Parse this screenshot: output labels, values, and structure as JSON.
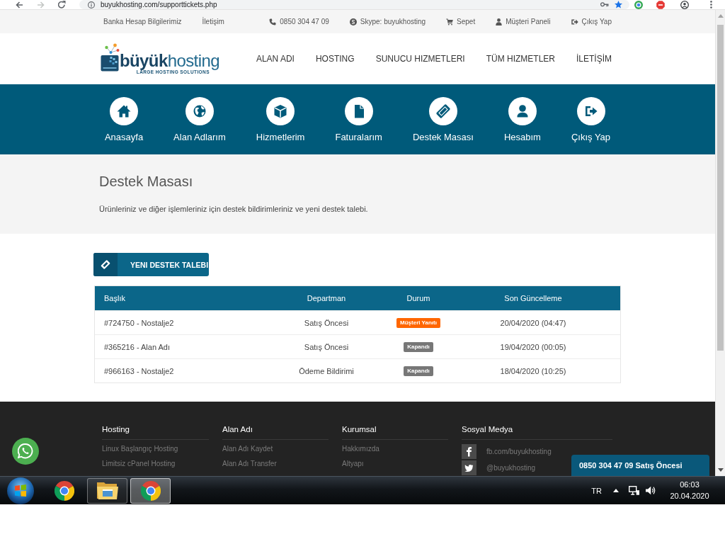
{
  "browser": {
    "url": "buyukhosting.com/supporttickets.php"
  },
  "top_bar": {
    "links": [
      {
        "label": "Banka Hesap Bilgilerimiz"
      },
      {
        "label": "İletişim"
      }
    ],
    "contacts": [
      {
        "kind": "phone",
        "label": "0850 304 47 09"
      },
      {
        "kind": "skype",
        "label": "Skype: buyukhosting"
      },
      {
        "kind": "cart",
        "label": "Sepet"
      },
      {
        "kind": "user",
        "label": "Müşteri Paneli"
      },
      {
        "kind": "logout",
        "label": "Çıkış Yap"
      }
    ]
  },
  "header": {
    "logo": {
      "wordmark": "**büyük**hosting",
      "tagline": "LARGE HOSTING SOLUTIONS"
    },
    "nav": [
      "ALAN ADI",
      "HOSTING",
      "SUNUCU HIZMETLERI",
      "TÜM HIZMETLER",
      "İLETİŞİM"
    ]
  },
  "quick_menu": [
    {
      "kind": "home",
      "label": "Anasayfa"
    },
    {
      "kind": "globe",
      "label": "Alan Adlarım"
    },
    {
      "kind": "box",
      "label": "Hizmetlerim"
    },
    {
      "kind": "file",
      "label": "Faturalarım"
    },
    {
      "kind": "ticket",
      "label": "Destek Masası"
    },
    {
      "kind": "user",
      "label": "Hesabım"
    },
    {
      "kind": "logout",
      "label": "Çıkış Yap"
    }
  ],
  "page_header": {
    "title": "Destek Masası",
    "description": "Ürünleriniz ve diğer işlemleriniz için destek bildirimleriniz ve yeni destek talebi."
  },
  "new_ticket_button": {
    "label": "YENI DESTEK TALEBI"
  },
  "table": {
    "columns": [
      "Başlık",
      "Departman",
      "Durum",
      "Son Güncelleme"
    ],
    "rows": [
      {
        "title": "#724750 - Nostalje2",
        "department": "Satış Öncesi",
        "status": "Müşteri Yanıtı",
        "color": "#ff6600",
        "updated": "20/04/2020 (04:47)"
      },
      {
        "title": "#365216 - Alan Adı",
        "department": "Satış Öncesi",
        "status": "Kapandı",
        "color": "#777777",
        "updated": "19/04/2020 (00:05)"
      },
      {
        "title": "#966163 - Nostalje2",
        "department": "Ödeme Bildirimi",
        "status": "Kapandı",
        "color": "#777777",
        "updated": "18/04/2020 (10:25)"
      }
    ]
  },
  "footer": {
    "columns": [
      {
        "title": "Hosting",
        "links": [
          "Linux Başlangıç Hosting",
          "Limitsiz cPanel Hosting"
        ]
      },
      {
        "title": "Alan Adı",
        "links": [
          "Alan Adı Kaydet",
          "Alan Adı Transfer"
        ]
      },
      {
        "title": "Kurumsal",
        "links": [
          "Hakkımızda",
          "Altyapı"
        ]
      }
    ],
    "social": {
      "title": "Sosyal Medya",
      "items": [
        {
          "kind": "facebook",
          "label": "fb.com/buyukhosting"
        },
        {
          "kind": "twitter",
          "label": "@buyukhosting"
        }
      ]
    }
  },
  "chat_widget": {
    "label": "0850 304 47 09 Satış Öncesi"
  },
  "taskbar": {
    "apps": [
      {
        "kind": "browser",
        "running": false,
        "selected": false
      },
      {
        "kind": "folder",
        "running": true,
        "selected": false
      },
      {
        "kind": "browser",
        "running": true,
        "selected": true
      }
    ],
    "tray": {
      "language": "TR",
      "time": "06:03",
      "date": "20.04.2020"
    }
  }
}
